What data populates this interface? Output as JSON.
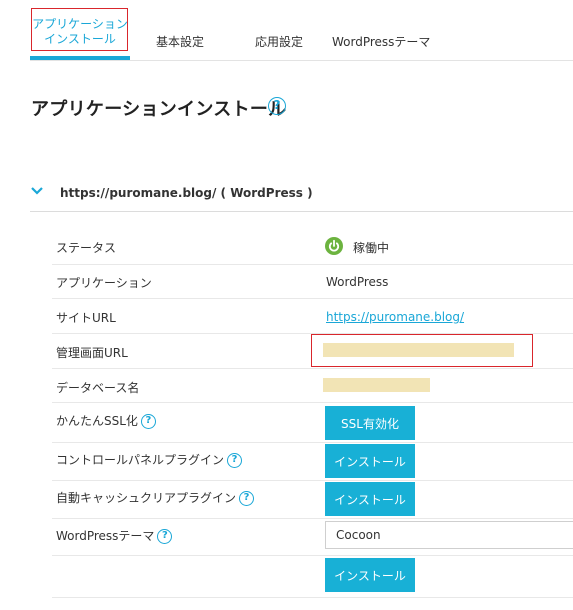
{
  "tabs": [
    {
      "line1": "アプリケーション",
      "line2": "インストール"
    },
    {
      "label": "基本設定"
    },
    {
      "label": "応用設定"
    },
    {
      "label": "WordPressテーマ"
    }
  ],
  "page": {
    "title": "アプリケーションインストール",
    "help": "?"
  },
  "install": {
    "header": "https://puromane.blog/ ( WordPress )",
    "rows": {
      "status": {
        "label": "ステータス",
        "value": "稼働中"
      },
      "application": {
        "label": "アプリケーション",
        "value": "WordPress"
      },
      "site_url": {
        "label": "サイトURL",
        "value": "https://puromane.blog/"
      },
      "admin_url": {
        "label": "管理画面URL"
      },
      "database": {
        "label": "データベース名"
      },
      "easy_ssl": {
        "label": "かんたんSSL化",
        "button": "SSL有効化"
      },
      "cp_plugin": {
        "label": "コントロールパネルプラグイン",
        "button": "インストール"
      },
      "cache_plugin": {
        "label": "自動キャッシュクリアプラグイン",
        "button": "インストール"
      },
      "wp_theme": {
        "label": "WordPressテーマ",
        "selected": "Cocoon",
        "button": "インストール"
      }
    }
  },
  "colors": {
    "accent": "#1aa7d7",
    "button": "#18b0d6",
    "status_green": "#6cb33f",
    "highlight_red": "#d9262c",
    "masked": "#f2e4b5"
  }
}
